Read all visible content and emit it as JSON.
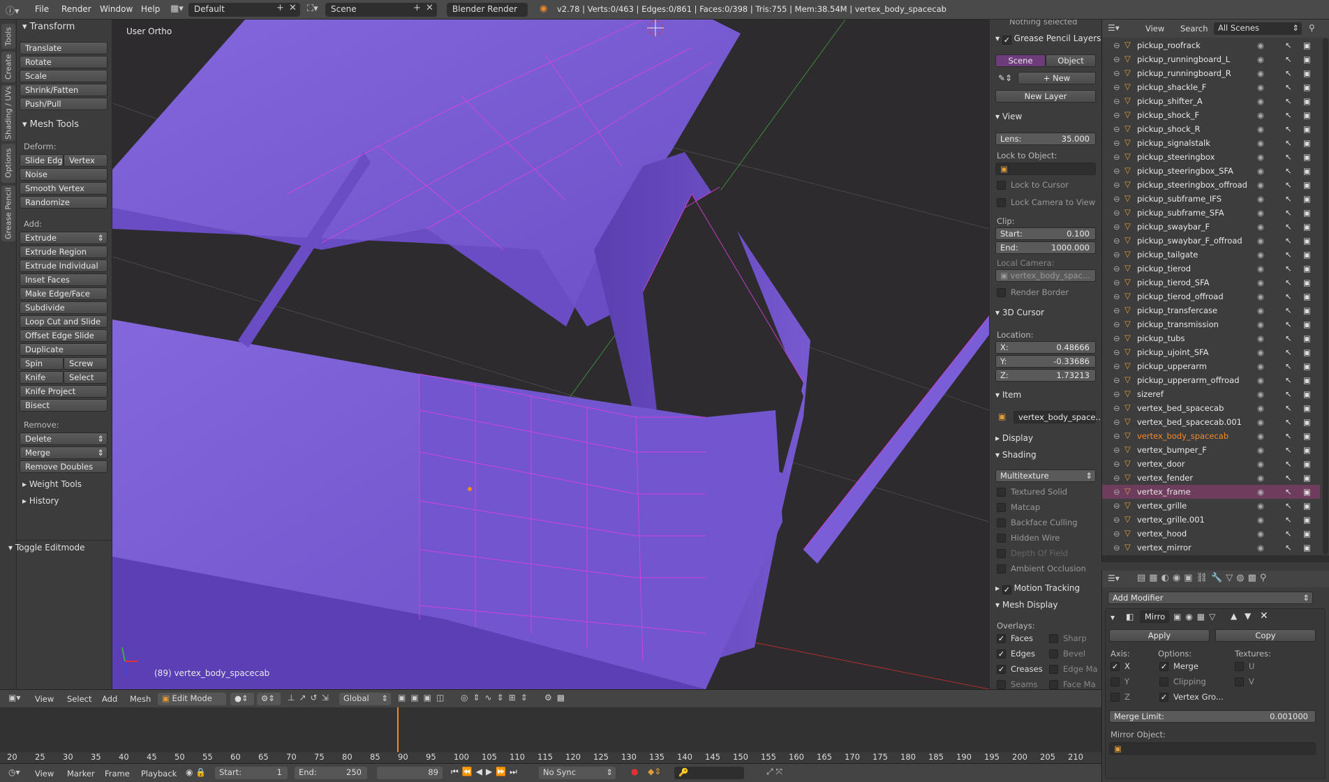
{
  "topbar": {
    "menus": [
      "File",
      "Render",
      "Window",
      "Help"
    ],
    "layout": "Default",
    "scene": "Scene",
    "engine": "Blender Render",
    "stats": "v2.78 | Verts:0/463 | Edges:0/861 | Faces:0/398 | Tris:755 | Mem:38.54M | vertex_body_spacecab"
  },
  "left_tabs": [
    "Tools",
    "Create",
    "Shading / UVs",
    "Options",
    "Grease Pencil"
  ],
  "toolshelf": {
    "transform_header": "Transform",
    "transform": [
      "Translate",
      "Rotate",
      "Scale",
      "Shrink/Fatten",
      "Push/Pull"
    ],
    "mesh_tools_header": "Mesh Tools",
    "deform_label": "Deform:",
    "slide_edge": "Slide Edge",
    "vertex": "Vertex",
    "noise": "Noise",
    "smooth_vertex": "Smooth Vertex",
    "randomize": "Randomize",
    "add_label": "Add:",
    "extrude": "Extrude",
    "add_tools": [
      "Extrude Region",
      "Extrude Individual",
      "Inset Faces",
      "Make Edge/Face",
      "Subdivide",
      "Loop Cut and Slide",
      "Offset Edge Slide",
      "Duplicate"
    ],
    "spin": "Spin",
    "screw": "Screw",
    "knife": "Knife",
    "select": "Select",
    "knife_project": "Knife Project",
    "bisect": "Bisect",
    "remove_label": "Remove:",
    "delete": "Delete",
    "merge": "Merge",
    "remove_doubles": "Remove Doubles",
    "weight_tools": "Weight Tools",
    "history": "History",
    "toggle_editmode": "Toggle Editmode"
  },
  "viewport": {
    "view_name": "User Ortho",
    "object_label": "(89) vertex_body_spacecab"
  },
  "props": {
    "nothing_selected": "Nothing selected",
    "grease_pencil_layers": "Grease Pencil Layers",
    "scene_tab": "Scene",
    "object_tab": "Object",
    "new": "New",
    "new_layer": "New Layer",
    "view_header": "View",
    "lens_label": "Lens:",
    "lens_value": "35.000",
    "lock_to_object": "Lock to Object:",
    "lock_to_cursor": "Lock to Cursor",
    "lock_camera": "Lock Camera to View",
    "clip_label": "Clip:",
    "start_label": "Start:",
    "start_value": "0.100",
    "end_label": "End:",
    "end_value": "1000.000",
    "local_camera": "Local Camera:",
    "camera_value": "vertex_body_spac...",
    "render_border": "Render Border",
    "cursor_header": "3D Cursor",
    "location_label": "Location:",
    "x_label": "X:",
    "x_value": "0.48666",
    "y_label": "Y:",
    "y_value": "-0.33686",
    "z_label": "Z:",
    "z_value": "1.73213",
    "item_header": "Item",
    "item_value": "vertex_body_space...",
    "display_header": "Display",
    "shading_header": "Shading",
    "shading_mode": "Multitexture",
    "shading_opts": [
      "Textured Solid",
      "Matcap",
      "Backface Culling",
      "Hidden Wire",
      "Depth Of Field",
      "Ambient Occlusion"
    ],
    "motion_tracking": "Motion Tracking",
    "mesh_display": "Mesh Display",
    "overlays": "Overlays:",
    "faces": "Faces",
    "sharp": "Sharp",
    "edges": "Edges",
    "bevel": "Bevel",
    "creases": "Creases",
    "edge_ma": "Edge Ma",
    "seams": "Seams",
    "face_ma": "Face Ma"
  },
  "outliner": {
    "view": "View",
    "search": "Search",
    "all_scenes": "All Scenes",
    "items": [
      "pickup_roofrack",
      "pickup_runningboard_L",
      "pickup_runningboard_R",
      "pickup_shackle_F",
      "pickup_shifter_A",
      "pickup_shock_F",
      "pickup_shock_R",
      "pickup_signalstalk",
      "pickup_steeringbox",
      "pickup_steeringbox_SFA",
      "pickup_steeringbox_offroad",
      "pickup_subframe_IFS",
      "pickup_subframe_SFA",
      "pickup_swaybar_F",
      "pickup_swaybar_F_offroad",
      "pickup_tailgate",
      "pickup_tierod",
      "pickup_tierod_SFA",
      "pickup_tierod_offroad",
      "pickup_transfercase",
      "pickup_transmission",
      "pickup_tubs",
      "pickup_ujoint_SFA",
      "pickup_upperarm",
      "pickup_upperarm_offroad",
      "sizeref",
      "vertex_bed_spacecab",
      "vertex_bed_spacecab.001",
      "vertex_body_spacecab",
      "vertex_bumper_F",
      "vertex_door",
      "vertex_fender",
      "vertex_frame",
      "vertex_grille",
      "vertex_grille.001",
      "vertex_hood",
      "vertex_mirror"
    ],
    "active_item": "vertex_body_spacecab",
    "highlight_item": "vertex_frame"
  },
  "modifier": {
    "add_modifier": "Add Modifier",
    "name": "Mirro",
    "apply": "Apply",
    "copy": "Copy",
    "axis": "Axis:",
    "options": "Options:",
    "textures": "Textures:",
    "x": "X",
    "y": "Y",
    "z": "Z",
    "merge": "Merge",
    "clipping": "Clipping",
    "vertex_gro": "Vertex Gro...",
    "u": "U",
    "v": "V",
    "merge_limit_label": "Merge Limit:",
    "merge_limit_value": "0.001000",
    "mirror_object": "Mirror Object:"
  },
  "view_header": {
    "menus": [
      "View",
      "Select",
      "Add",
      "Mesh"
    ],
    "mode": "Edit Mode",
    "orientation": "Global"
  },
  "timeline": {
    "ticks": [
      "20",
      "25",
      "30",
      "35",
      "40",
      "45",
      "50",
      "55",
      "60",
      "65",
      "70",
      "75",
      "80",
      "85",
      "90",
      "95",
      "100",
      "105",
      "110",
      "115",
      "120",
      "125",
      "130",
      "135",
      "140",
      "145",
      "150",
      "155",
      "160",
      "165",
      "170",
      "175",
      "180",
      "185",
      "190",
      "195",
      "200",
      "205",
      "210"
    ],
    "current_frame": 89
  },
  "timeline_footer": {
    "menus": [
      "View",
      "Marker",
      "Frame",
      "Playback"
    ],
    "start_label": "Start:",
    "start_value": "1",
    "end_label": "End:",
    "end_value": "250",
    "frame": "89",
    "sync": "No Sync"
  },
  "colors": {
    "mesh": "#7b5bd6",
    "wire": "#e040e0",
    "active_text": "#f08a2c",
    "highlight_row": "#6e3c5c"
  }
}
